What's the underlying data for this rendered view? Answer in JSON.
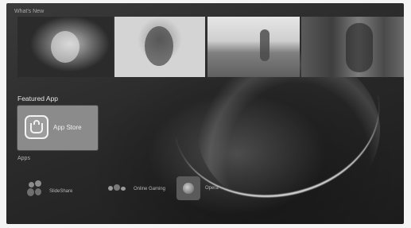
{
  "sections": {
    "whats_new": "What's New",
    "featured": "Featured App",
    "apps": "Apps"
  },
  "whats_new_tiles": [
    {
      "icon": "movie-poster"
    },
    {
      "icon": "movie-poster"
    },
    {
      "icon": "movie-poster"
    },
    {
      "icon": "movie-poster"
    }
  ],
  "featured_app": {
    "name": "App Store",
    "icon": "shopping-bag-icon"
  },
  "apps": [
    {
      "name": "SlideShare",
      "icon": "slideshare-icon"
    },
    {
      "name": "Online Gaming",
      "icon": "gaming-icon"
    },
    {
      "name": "Opera",
      "icon": "globe-icon"
    }
  ],
  "colors": {
    "background": "#2a2a2a",
    "card": "#8b8b8b",
    "text": "#e6e6e6"
  }
}
